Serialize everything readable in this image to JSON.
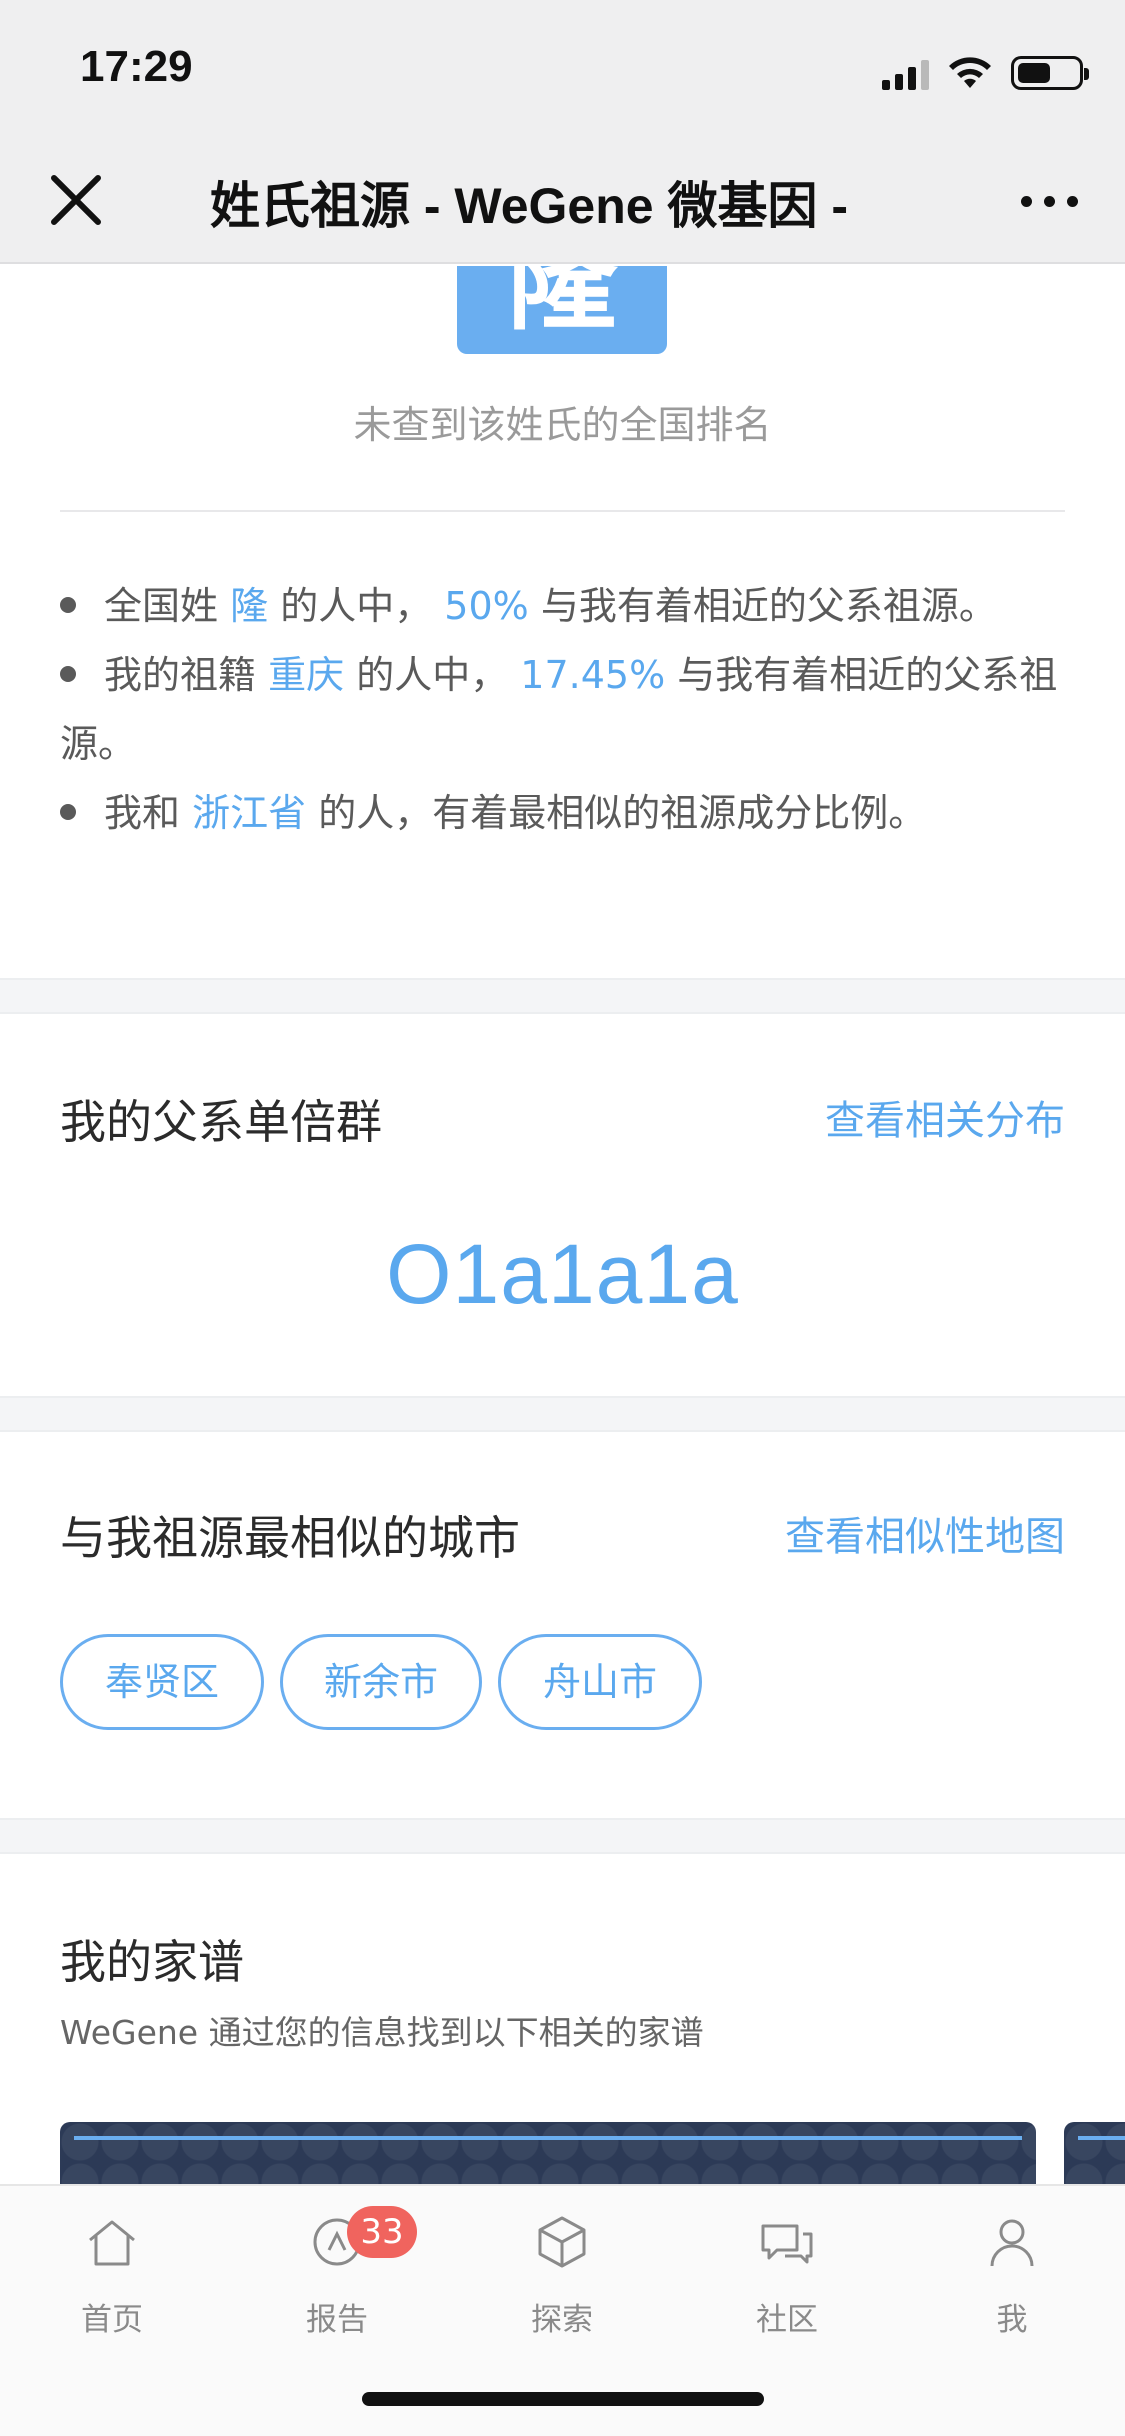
{
  "status_bar": {
    "time": "17:29",
    "battery_level": 0.55
  },
  "nav": {
    "title": "姓氏祖源 - WeGene 微基因 -"
  },
  "surname": {
    "char": "隆",
    "rank_note": "未查到该姓氏的全国排名"
  },
  "facts": [
    {
      "pre": "全国姓 ",
      "hl1": "隆",
      "mid": " 的人中， ",
      "hl2": "50%",
      "post": " 与我有着相近的父系祖源。"
    },
    {
      "pre": "我的祖籍 ",
      "hl1": "重庆",
      "mid": " 的人中， ",
      "hl2": "17.45%",
      "post": " 与我有着相近的父系祖源。"
    },
    {
      "pre": "我和 ",
      "hl1": "浙江省",
      "mid": " 的人，有着最相似的祖源成分比例。",
      "hl2": "",
      "post": ""
    }
  ],
  "haplogroup": {
    "title": "我的父系单倍群",
    "link": "查看相关分布",
    "value": "O1a1a1a"
  },
  "similar_cities": {
    "title": "与我祖源最相似的城市",
    "link": "查看相似性地图",
    "cities": [
      "奉贤区",
      "新余市",
      "舟山市"
    ]
  },
  "family_tree": {
    "title": "我的家谱",
    "subtitle": "WeGene 通过您的信息找到以下相关的家谱"
  },
  "colors": {
    "accent": "#5aa8ee",
    "badge": "#f0645e",
    "card": "#2c3a56"
  },
  "tabs": [
    {
      "label": "首页",
      "icon": "home-icon"
    },
    {
      "label": "报告",
      "icon": "report-icon",
      "badge": "33"
    },
    {
      "label": "探索",
      "icon": "cube-icon"
    },
    {
      "label": "社区",
      "icon": "chat-icon"
    },
    {
      "label": "我",
      "icon": "profile-icon"
    }
  ]
}
